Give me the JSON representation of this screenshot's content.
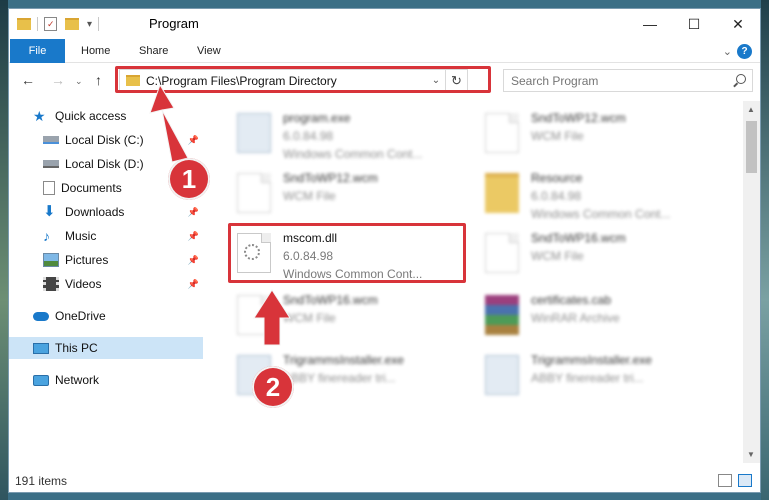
{
  "window": {
    "title": "Program",
    "controls": {
      "minimize": "—",
      "maximize": "☐",
      "close": "✕"
    }
  },
  "ribbon": {
    "tabs": [
      "File",
      "Home",
      "Share",
      "View"
    ],
    "help": "?"
  },
  "nav": {
    "address": "C:\\Program Files\\Program Directory",
    "search_placeholder": "Search Program"
  },
  "sidebar": {
    "items": [
      {
        "label": "Quick access",
        "icon": "star-icon",
        "pinned": false
      },
      {
        "label": "Local Disk (C:)",
        "icon": "drive-icon",
        "pinned": true
      },
      {
        "label": "Local Disk (D:)",
        "icon": "drive-icon",
        "pinned": false
      },
      {
        "label": "Documents",
        "icon": "documents-icon",
        "pinned": true
      },
      {
        "label": "Downloads",
        "icon": "download-icon",
        "pinned": true
      },
      {
        "label": "Music",
        "icon": "music-icon",
        "pinned": true
      },
      {
        "label": "Pictures",
        "icon": "pictures-icon",
        "pinned": true
      },
      {
        "label": "Videos",
        "icon": "videos-icon",
        "pinned": true
      },
      {
        "label": "OneDrive",
        "icon": "cloud-icon",
        "pinned": false
      },
      {
        "label": "This PC",
        "icon": "computer-icon",
        "pinned": false,
        "selected": true
      },
      {
        "label": "Network",
        "icon": "network-icon",
        "pinned": false
      }
    ]
  },
  "files": [
    {
      "name": "program.exe",
      "meta1": "6.0.84.98",
      "meta2": "Windows Common Cont...",
      "icon": "exe-icon",
      "blurred": true
    },
    {
      "name": "SndToWP12.wcm",
      "meta1": "WCM File",
      "meta2": "",
      "icon": "document-icon",
      "blurred": true
    },
    {
      "name": "SndToWP12.wcm",
      "meta1": "WCM File",
      "meta2": "",
      "icon": "document-icon",
      "blurred": true
    },
    {
      "name": "Resource",
      "meta1": "6.0.84.98",
      "meta2": "Windows Common Cont...",
      "icon": "folder-icon",
      "blurred": true
    },
    {
      "name": "mscom.dll",
      "meta1": "6.0.84.98",
      "meta2": "Windows Common Cont...",
      "icon": "dll-gear-icon",
      "blurred": false
    },
    {
      "name": "SndToWP16.wcm",
      "meta1": "WCM File",
      "meta2": "",
      "icon": "document-icon",
      "blurred": true
    },
    {
      "name": "SndToWP16.wcm",
      "meta1": "WCM File",
      "meta2": "",
      "icon": "document-icon",
      "blurred": true
    },
    {
      "name": "certificates.cab",
      "meta1": "WinRAR Archive",
      "meta2": "",
      "icon": "archive-icon",
      "blurred": true
    },
    {
      "name": "TrigrammsInstaller.exe",
      "meta1": "ABBY finereader tri...",
      "meta2": "",
      "icon": "exe-icon",
      "blurred": true
    },
    {
      "name": "TrigrammsInstaller.exe",
      "meta1": "ABBY finereader tri...",
      "meta2": "",
      "icon": "exe-icon",
      "blurred": true
    }
  ],
  "status": {
    "count": "191 items"
  },
  "annotations": {
    "step1": "1",
    "step2": "2",
    "accent": "#d8343a"
  }
}
